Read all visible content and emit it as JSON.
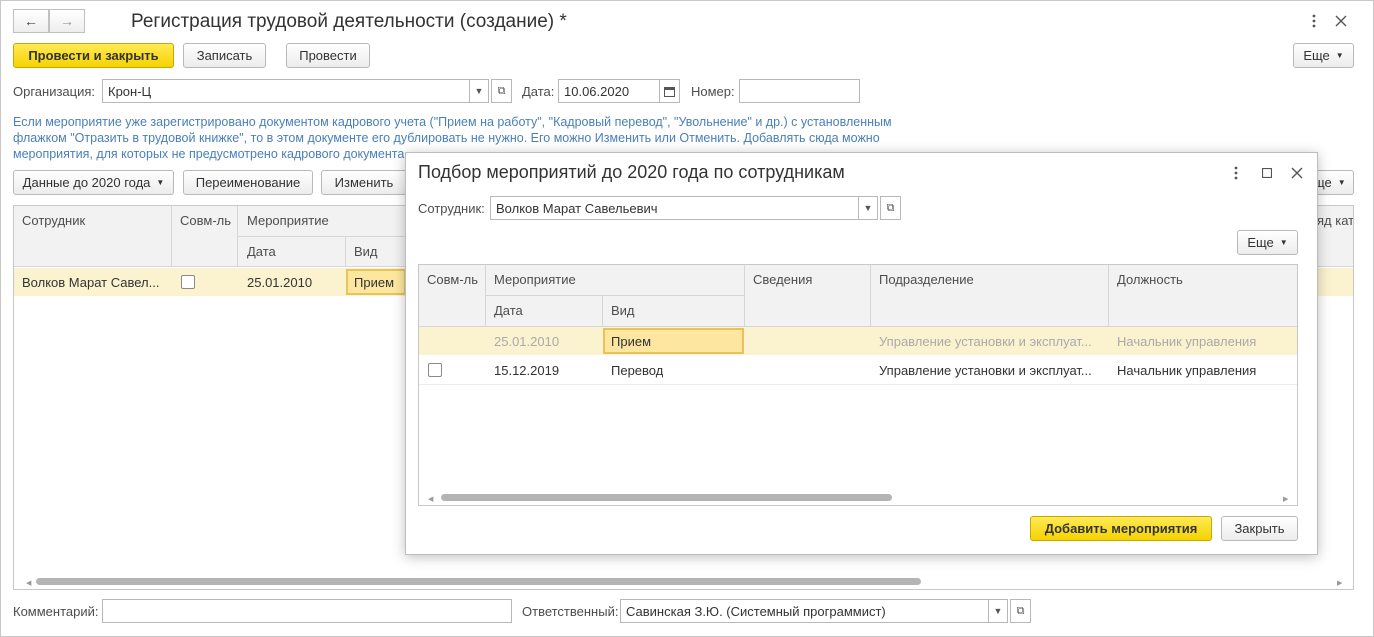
{
  "window": {
    "title": "Регистрация трудовой деятельности (создание) *",
    "nav_back": "←",
    "nav_forward": "→"
  },
  "toolbar": {
    "post_close": "Провести и закрыть",
    "save": "Записать",
    "post": "Провести",
    "more": "Еще"
  },
  "form": {
    "org_label": "Организация:",
    "org_value": "Крон-Ц",
    "date_label": "Дата:",
    "date_value": "10.06.2020",
    "number_label": "Номер:",
    "number_value": ""
  },
  "hint": {
    "line1": "Если мероприятие уже зарегистрировано документом кадрового учета (\"Прием на работу\", \"Кадровый перевод\", \"Увольнение\" и др.) с установленным",
    "line2": "флажком \"Отразить в трудовой книжке\", то в этом документе его дублировать не нужно. Его можно Изменить или Отменить. Добавлять сюда можно",
    "line3": "мероприятия, для которых не предусмотрено кадрового документа"
  },
  "table_toolbar": {
    "data_before_2020": "Данные до 2020 года",
    "rename": "Переименование",
    "change": "Изменить",
    "more_partial": "ще",
    "right_partial": "яд кат"
  },
  "main_table": {
    "col_employee": "Сотрудник",
    "col_parttime": "Совм-ль",
    "col_event": "Мероприятие",
    "col_date": "Дата",
    "col_kind": "Вид",
    "rows": [
      {
        "employee": "Волков Марат Савел...",
        "parttime": false,
        "date": "25.01.2010",
        "kind": "Прием"
      }
    ]
  },
  "dialog": {
    "title": "Подбор мероприятий до 2020 года по сотрудникам",
    "employee_label": "Сотрудник:",
    "employee_value": "Волков Марат Савельевич",
    "more": "Еще",
    "columns": {
      "parttime": "Совм-ль",
      "event": "Мероприятие",
      "date": "Дата",
      "kind": "Вид",
      "info": "Сведения",
      "department": "Подразделение",
      "position": "Должность"
    },
    "rows": [
      {
        "date": "25.01.2010",
        "kind": "Прием",
        "info": "",
        "department": "Управление установки и эксплуат...",
        "position": "Начальник управления",
        "checked": false
      },
      {
        "date": "15.12.2019",
        "kind": "Перевод",
        "info": "",
        "department": "Управление установки и эксплуат...",
        "position": "Начальник управления",
        "checked": false
      }
    ],
    "add_button": "Добавить мероприятия",
    "close_button": "Закрыть"
  },
  "footer": {
    "comment_label": "Комментарий:",
    "comment_value": "",
    "responsible_label": "Ответственный:",
    "responsible_value": "Савинская З.Ю. (Системный программист)"
  },
  "colors": {
    "accent_yellow": "#f5d300",
    "selected_row": "#fbf2cf",
    "hint_blue": "#4a7fb9"
  }
}
